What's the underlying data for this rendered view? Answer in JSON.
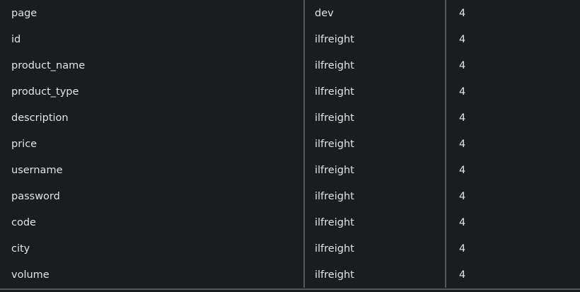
{
  "table": {
    "rows": [
      {
        "column": "page",
        "table": "dev",
        "count": "4"
      },
      {
        "column": "id",
        "table": "ilfreight",
        "count": "4"
      },
      {
        "column": "product_name",
        "table": "ilfreight",
        "count": "4"
      },
      {
        "column": "product_type",
        "table": "ilfreight",
        "count": "4"
      },
      {
        "column": "description",
        "table": "ilfreight",
        "count": "4"
      },
      {
        "column": "price",
        "table": "ilfreight",
        "count": "4"
      },
      {
        "column": "username",
        "table": "ilfreight",
        "count": "4"
      },
      {
        "column": "password",
        "table": "ilfreight",
        "count": "4"
      },
      {
        "column": "code",
        "table": "ilfreight",
        "count": "4"
      },
      {
        "column": "city",
        "table": "ilfreight",
        "count": "4"
      },
      {
        "column": "volume",
        "table": "ilfreight",
        "count": "4"
      }
    ]
  },
  "colors": {
    "background": "#1b1c1e",
    "text": "#e3e4e6",
    "divider": "#56575a"
  }
}
